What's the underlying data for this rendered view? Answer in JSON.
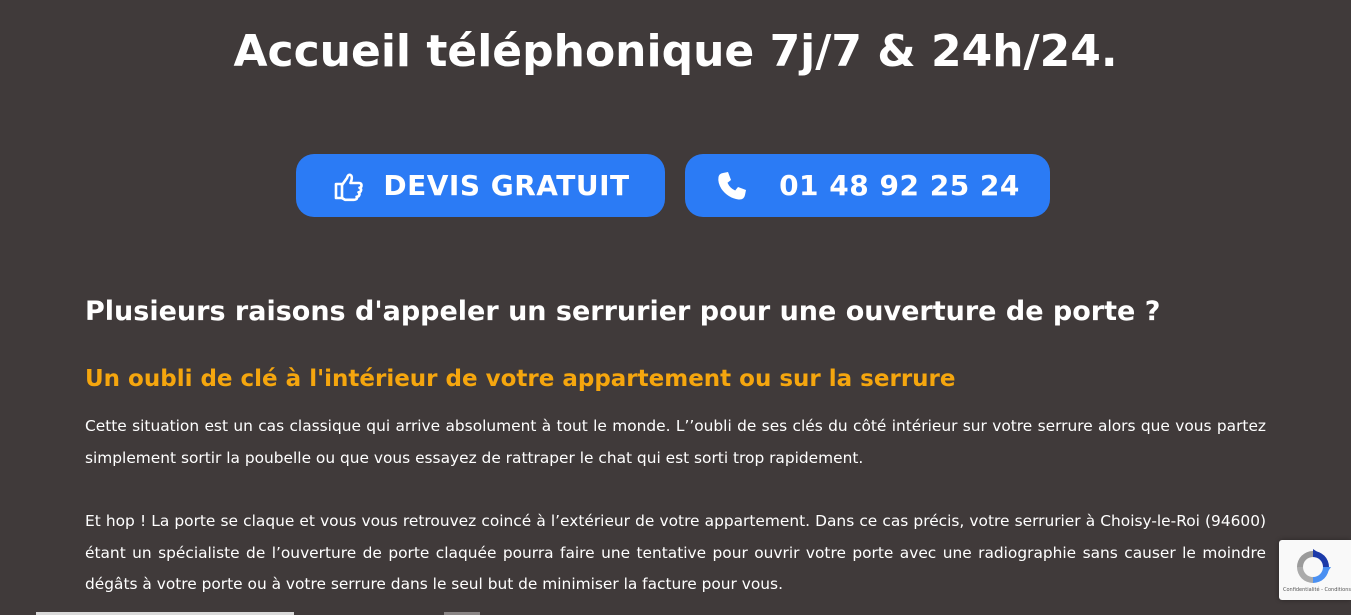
{
  "hero": {
    "title": "Accueil téléphonique 7j/7 & 24h/24."
  },
  "cta": {
    "quote_label": "DEVIS GRATUIT",
    "quote_icon": "thumbs-up-pointing-icon",
    "phone_label": "01 48 92 25 24",
    "phone_icon": "phone-icon",
    "button_color": "#2b7bf5"
  },
  "content": {
    "heading": "Plusieurs raisons d'appeler un serrurier pour une ouverture de porte ?",
    "subheading": "Un oubli de clé à l'intérieur de votre appartement ou sur la serrure",
    "subheading_color": "#f5a60e",
    "paragraph_1": "Cette situation est un cas classique qui arrive absolument à tout le monde. L’’oubli de ses clés du côté intérieur sur votre serrure alors que vous partez simplement sortir la poubelle ou que vous essayez de rattraper le chat qui est sorti trop rapidement.",
    "paragraph_2": "Et hop ! La porte se claque et vous vous retrouvez coincé à l’extérieur de votre appartement. Dans ce cas précis, votre serrurier à Choisy-le-Roi (94600) étant un spécialiste de l’ouverture de porte claquée pourra faire une tentative pour ouvrir votre porte avec une radiographie sans causer le moindre dégâts à votre porte ou à votre serrure dans le seul but de minimiser la facture pour vous."
  },
  "recaptcha": {
    "terms": "Confidentialité - Conditions"
  },
  "background_color": "#403a3a"
}
